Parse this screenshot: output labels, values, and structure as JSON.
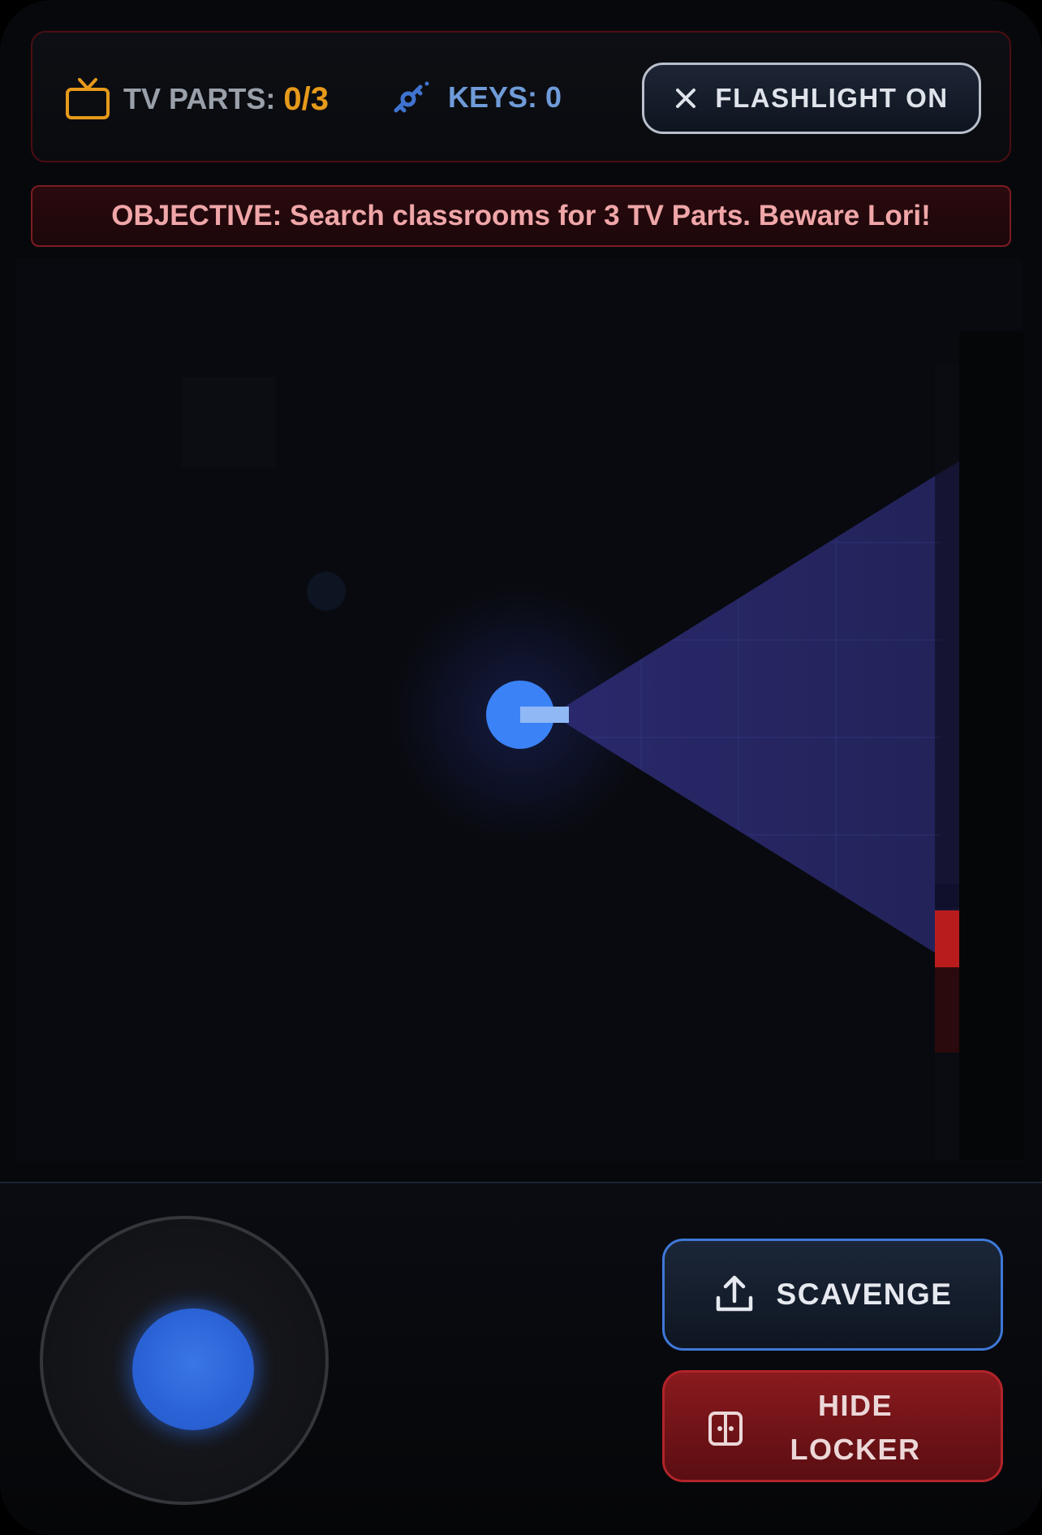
{
  "hud": {
    "tv_parts_label": "TV PARTS:",
    "tv_parts_value": "0/3",
    "keys_label": "KEYS:",
    "keys_value": "0",
    "flashlight_label": "FLASHLIGHT ON"
  },
  "objective": {
    "text": "OBJECTIVE: Search classrooms for 3 TV Parts. Beware Lori!"
  },
  "controls": {
    "scavenge_label": "SCAVENGE",
    "hide_label": "HIDE LOCKER"
  },
  "icons": {
    "tv": "tv-icon",
    "key": "key-icon",
    "close": "close-icon",
    "upload": "upload-icon",
    "locker": "locker-icon"
  },
  "colors": {
    "tv_parts_accent": "#e69a1a",
    "keys_accent": "#6f9bd8",
    "player": "#3b82f6",
    "flashlight_beam": "#2a2a6a",
    "danger": "#b91c1c"
  }
}
